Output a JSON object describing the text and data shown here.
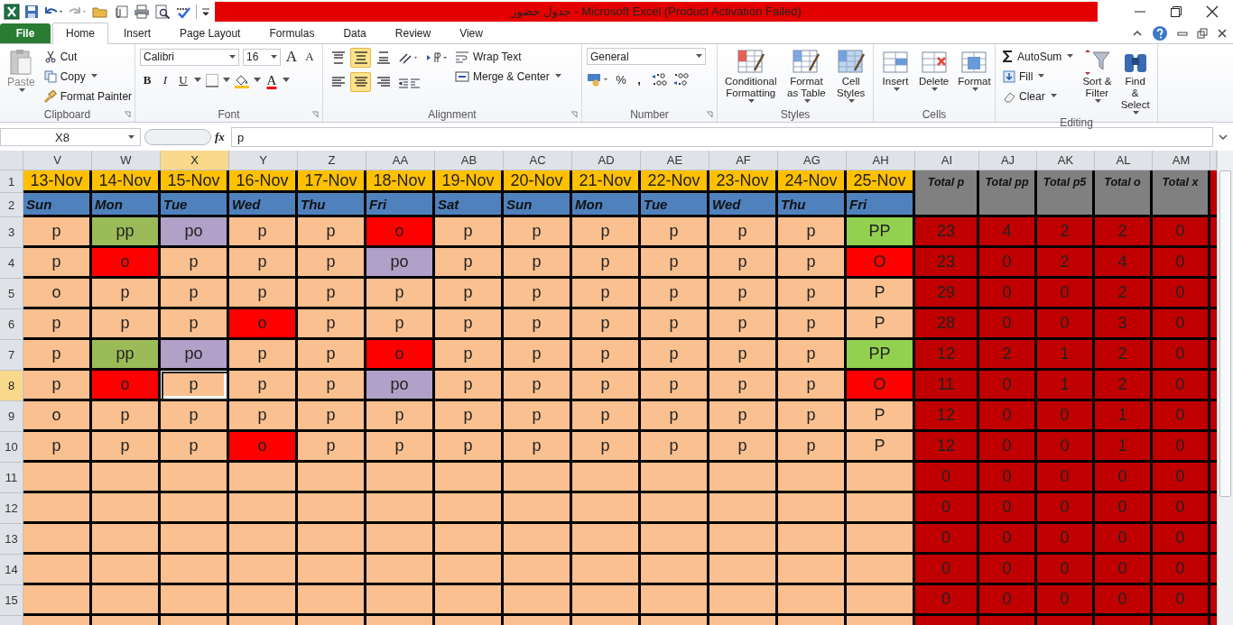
{
  "window": {
    "title": "جدول حضور  -  Microsoft Excel (Product Activation Failed)"
  },
  "tabs": [
    {
      "label": "File",
      "kind": "file",
      "selected": false
    },
    {
      "label": "Home",
      "kind": "tab",
      "selected": true
    },
    {
      "label": "Insert",
      "kind": "tab",
      "selected": false
    },
    {
      "label": "Page Layout",
      "kind": "tab",
      "selected": false
    },
    {
      "label": "Formulas",
      "kind": "tab",
      "selected": false
    },
    {
      "label": "Data",
      "kind": "tab",
      "selected": false
    },
    {
      "label": "Review",
      "kind": "tab",
      "selected": false
    },
    {
      "label": "View",
      "kind": "tab",
      "selected": false
    }
  ],
  "ribbon": {
    "clipboard": {
      "label": "Clipboard",
      "paste": "Paste",
      "cut": "Cut",
      "copy": "Copy",
      "format_painter": "Format Painter"
    },
    "font": {
      "label": "Font",
      "name": "Calibri",
      "size": "16",
      "grow": "A",
      "shrink": "A",
      "bold": "B",
      "italic": "I",
      "underline": "U",
      "color_letter": "A"
    },
    "alignment": {
      "label": "Alignment",
      "wrap_text": "Wrap Text",
      "merge_center": "Merge & Center",
      "buttons": [
        {
          "kind": "top",
          "selected": false
        },
        {
          "kind": "middle",
          "selected": true
        },
        {
          "kind": "bottom",
          "selected": false
        },
        {
          "kind": "left",
          "selected": false
        },
        {
          "kind": "center",
          "selected": true
        },
        {
          "kind": "right",
          "selected": false
        }
      ]
    },
    "number": {
      "label": "Number",
      "format": "General",
      "percent": "%",
      "comma": ","
    },
    "styles": {
      "label": "Styles",
      "buttons": [
        "Conditional Formatting",
        "Format as Table",
        "Cell Styles"
      ]
    },
    "cells": {
      "label": "Cells",
      "buttons": [
        "Insert",
        "Delete",
        "Format"
      ]
    },
    "editing": {
      "label": "Editing",
      "autosum": "AutoSum",
      "fill": "Fill",
      "clear": "Clear",
      "sort": "Sort & Filter",
      "find": "Find & Select"
    }
  },
  "formula_bar": {
    "name_box": "X8",
    "fx": "fx",
    "value": "p"
  },
  "sheet": {
    "columns": [
      {
        "letter": "V",
        "selected": false
      },
      {
        "letter": "W",
        "selected": false
      },
      {
        "letter": "X",
        "selected": true
      },
      {
        "letter": "Y",
        "selected": false
      },
      {
        "letter": "Z",
        "selected": false
      },
      {
        "letter": "AA",
        "selected": false
      },
      {
        "letter": "AB",
        "selected": false
      },
      {
        "letter": "AC",
        "selected": false
      },
      {
        "letter": "AD",
        "selected": false
      },
      {
        "letter": "AE",
        "selected": false
      },
      {
        "letter": "AF",
        "selected": false
      },
      {
        "letter": "AG",
        "selected": false
      },
      {
        "letter": "AH",
        "selected": false
      },
      {
        "letter": "AI",
        "selected": false
      },
      {
        "letter": "AJ",
        "selected": false
      },
      {
        "letter": "AK",
        "selected": false
      },
      {
        "letter": "AL",
        "selected": false
      },
      {
        "letter": "AM",
        "selected": false
      }
    ],
    "header_rows": [
      {
        "number": "1",
        "selected": false
      },
      {
        "number": "2",
        "selected": false
      }
    ],
    "dates": [
      "13-Nov",
      "14-Nov",
      "15-Nov",
      "16-Nov",
      "17-Nov",
      "18-Nov",
      "19-Nov",
      "20-Nov",
      "21-Nov",
      "22-Nov",
      "23-Nov",
      "24-Nov",
      "25-Nov"
    ],
    "days": [
      "Sun",
      "Mon",
      "Tue",
      "Wed",
      "Thu",
      "Fri",
      "Sat",
      "Sun",
      "Mon",
      "Tue",
      "Wed",
      "Thu",
      "Fri"
    ],
    "total_headers": [
      "Total  p",
      "Total  pp",
      "Total  p5",
      "Total o",
      "Total  x"
    ],
    "rows": [
      {
        "number": "3",
        "selected": false,
        "cells": [
          {
            "text": "p",
            "color": "#fac090"
          },
          {
            "text": "pp",
            "color": "#9bbb59"
          },
          {
            "text": "po",
            "color": "#b1a0c7"
          },
          {
            "text": "p",
            "color": "#fac090"
          },
          {
            "text": "p",
            "color": "#fac090"
          },
          {
            "text": "o",
            "color": "#ff0000"
          },
          {
            "text": "p",
            "color": "#fac090"
          },
          {
            "text": "p",
            "color": "#fac090"
          },
          {
            "text": "p",
            "color": "#fac090"
          },
          {
            "text": "p",
            "color": "#fac090"
          },
          {
            "text": "p",
            "color": "#fac090"
          },
          {
            "text": "p",
            "color": "#fac090"
          },
          {
            "text": "PP",
            "color": "#92d050"
          }
        ],
        "totals": [
          "23",
          "4",
          "2",
          "2",
          "0"
        ]
      },
      {
        "number": "4",
        "selected": false,
        "cells": [
          {
            "text": "p",
            "color": "#fac090"
          },
          {
            "text": "o",
            "color": "#ff0000"
          },
          {
            "text": "p",
            "color": "#fac090"
          },
          {
            "text": "p",
            "color": "#fac090"
          },
          {
            "text": "p",
            "color": "#fac090"
          },
          {
            "text": "po",
            "color": "#b1a0c7"
          },
          {
            "text": "p",
            "color": "#fac090"
          },
          {
            "text": "p",
            "color": "#fac090"
          },
          {
            "text": "p",
            "color": "#fac090"
          },
          {
            "text": "p",
            "color": "#fac090"
          },
          {
            "text": "p",
            "color": "#fac090"
          },
          {
            "text": "p",
            "color": "#fac090"
          },
          {
            "text": "O",
            "color": "#ff0000"
          }
        ],
        "totals": [
          "23",
          "0",
          "2",
          "4",
          "0"
        ]
      },
      {
        "number": "5",
        "selected": false,
        "cells": [
          {
            "text": "o",
            "color": "#fac090"
          },
          {
            "text": "p",
            "color": "#fac090"
          },
          {
            "text": "p",
            "color": "#fac090"
          },
          {
            "text": "p",
            "color": "#fac090"
          },
          {
            "text": "p",
            "color": "#fac090"
          },
          {
            "text": "p",
            "color": "#fac090"
          },
          {
            "text": "p",
            "color": "#fac090"
          },
          {
            "text": "p",
            "color": "#fac090"
          },
          {
            "text": "p",
            "color": "#fac090"
          },
          {
            "text": "p",
            "color": "#fac090"
          },
          {
            "text": "p",
            "color": "#fac090"
          },
          {
            "text": "p",
            "color": "#fac090"
          },
          {
            "text": "P",
            "color": "#fac090"
          }
        ],
        "totals": [
          "29",
          "0",
          "0",
          "2",
          "0"
        ]
      },
      {
        "number": "6",
        "selected": false,
        "cells": [
          {
            "text": "p",
            "color": "#fac090"
          },
          {
            "text": "p",
            "color": "#fac090"
          },
          {
            "text": "p",
            "color": "#fac090"
          },
          {
            "text": "o",
            "color": "#ff0000"
          },
          {
            "text": "p",
            "color": "#fac090"
          },
          {
            "text": "p",
            "color": "#fac090"
          },
          {
            "text": "p",
            "color": "#fac090"
          },
          {
            "text": "p",
            "color": "#fac090"
          },
          {
            "text": "p",
            "color": "#fac090"
          },
          {
            "text": "p",
            "color": "#fac090"
          },
          {
            "text": "p",
            "color": "#fac090"
          },
          {
            "text": "p",
            "color": "#fac090"
          },
          {
            "text": "P",
            "color": "#fac090"
          }
        ],
        "totals": [
          "28",
          "0",
          "0",
          "3",
          "0"
        ]
      },
      {
        "number": "7",
        "selected": false,
        "cells": [
          {
            "text": "p",
            "color": "#fac090"
          },
          {
            "text": "pp",
            "color": "#9bbb59"
          },
          {
            "text": "po",
            "color": "#b1a0c7"
          },
          {
            "text": "p",
            "color": "#fac090"
          },
          {
            "text": "p",
            "color": "#fac090"
          },
          {
            "text": "o",
            "color": "#ff0000"
          },
          {
            "text": "p",
            "color": "#fac090"
          },
          {
            "text": "p",
            "color": "#fac090"
          },
          {
            "text": "p",
            "color": "#fac090"
          },
          {
            "text": "p",
            "color": "#fac090"
          },
          {
            "text": "p",
            "color": "#fac090"
          },
          {
            "text": "p",
            "color": "#fac090"
          },
          {
            "text": "PP",
            "color": "#92d050"
          }
        ],
        "totals": [
          "12",
          "2",
          "1",
          "2",
          "0"
        ]
      },
      {
        "number": "8",
        "selected": true,
        "cells": [
          {
            "text": "p",
            "color": "#fac090"
          },
          {
            "text": "o",
            "color": "#ff0000"
          },
          {
            "text": "p",
            "color": "#fac090"
          },
          {
            "text": "p",
            "color": "#fac090"
          },
          {
            "text": "p",
            "color": "#fac090"
          },
          {
            "text": "po",
            "color": "#b1a0c7"
          },
          {
            "text": "p",
            "color": "#fac090"
          },
          {
            "text": "p",
            "color": "#fac090"
          },
          {
            "text": "p",
            "color": "#fac090"
          },
          {
            "text": "p",
            "color": "#fac090"
          },
          {
            "text": "p",
            "color": "#fac090"
          },
          {
            "text": "p",
            "color": "#fac090"
          },
          {
            "text": "O",
            "color": "#ff0000"
          }
        ],
        "totals": [
          "11",
          "0",
          "1",
          "2",
          "0"
        ]
      },
      {
        "number": "9",
        "selected": false,
        "cells": [
          {
            "text": "o",
            "color": "#fac090"
          },
          {
            "text": "p",
            "color": "#fac090"
          },
          {
            "text": "p",
            "color": "#fac090"
          },
          {
            "text": "p",
            "color": "#fac090"
          },
          {
            "text": "p",
            "color": "#fac090"
          },
          {
            "text": "p",
            "color": "#fac090"
          },
          {
            "text": "p",
            "color": "#fac090"
          },
          {
            "text": "p",
            "color": "#fac090"
          },
          {
            "text": "p",
            "color": "#fac090"
          },
          {
            "text": "p",
            "color": "#fac090"
          },
          {
            "text": "p",
            "color": "#fac090"
          },
          {
            "text": "p",
            "color": "#fac090"
          },
          {
            "text": "P",
            "color": "#fac090"
          }
        ],
        "totals": [
          "12",
          "0",
          "0",
          "1",
          "0"
        ]
      },
      {
        "number": "10",
        "selected": false,
        "cells": [
          {
            "text": "p",
            "color": "#fac090"
          },
          {
            "text": "p",
            "color": "#fac090"
          },
          {
            "text": "p",
            "color": "#fac090"
          },
          {
            "text": "o",
            "color": "#ff0000"
          },
          {
            "text": "p",
            "color": "#fac090"
          },
          {
            "text": "p",
            "color": "#fac090"
          },
          {
            "text": "p",
            "color": "#fac090"
          },
          {
            "text": "p",
            "color": "#fac090"
          },
          {
            "text": "p",
            "color": "#fac090"
          },
          {
            "text": "p",
            "color": "#fac090"
          },
          {
            "text": "p",
            "color": "#fac090"
          },
          {
            "text": "p",
            "color": "#fac090"
          },
          {
            "text": "P",
            "color": "#fac090"
          }
        ],
        "totals": [
          "12",
          "0",
          "0",
          "1",
          "0"
        ]
      },
      {
        "number": "11",
        "selected": false,
        "cells": [],
        "totals": [
          "0",
          "0",
          "0",
          "0",
          "0"
        ]
      },
      {
        "number": "12",
        "selected": false,
        "cells": [],
        "totals": [
          "0",
          "0",
          "0",
          "0",
          "0"
        ]
      },
      {
        "number": "13",
        "selected": false,
        "cells": [],
        "totals": [
          "0",
          "0",
          "0",
          "0",
          "0"
        ]
      },
      {
        "number": "14",
        "selected": false,
        "cells": [],
        "totals": [
          "0",
          "0",
          "0",
          "0",
          "0"
        ]
      },
      {
        "number": "15",
        "selected": false,
        "cells": [],
        "totals": [
          "0",
          "0",
          "0",
          "0",
          "0"
        ]
      }
    ]
  }
}
